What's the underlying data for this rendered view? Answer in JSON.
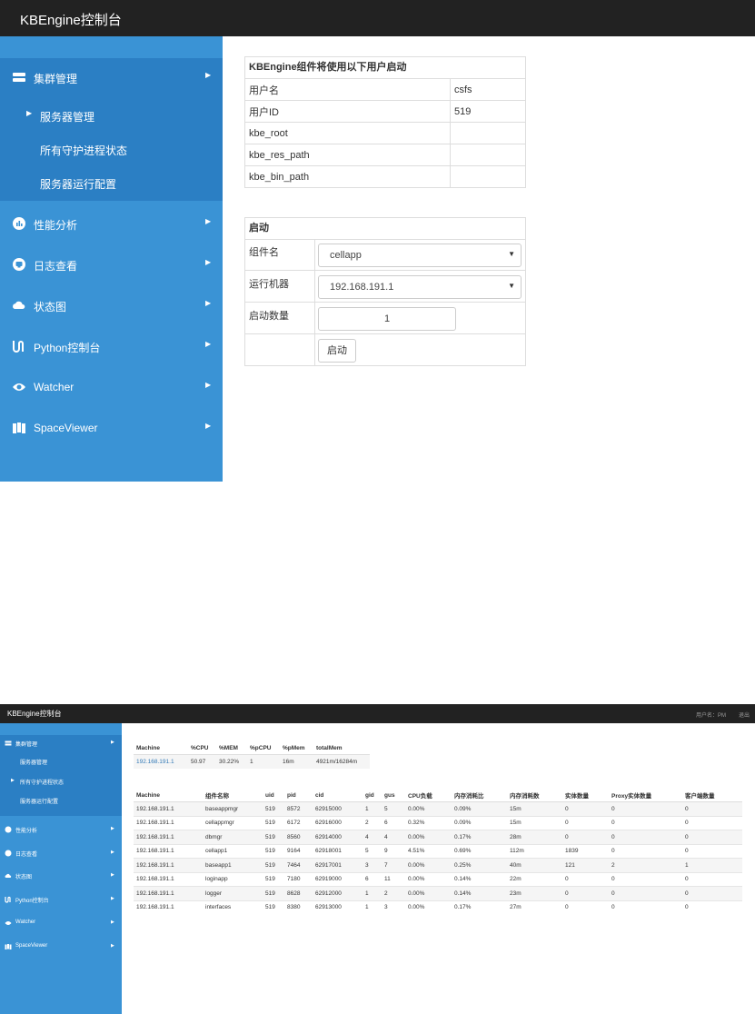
{
  "top": {
    "brand": "KBEngine控制台",
    "sidebar": {
      "groups": [
        {
          "label": "集群管理",
          "icon": "server-icon"
        },
        {
          "label": "性能分析",
          "icon": "chart-icon"
        },
        {
          "label": "日志查看",
          "icon": "log-icon"
        },
        {
          "label": "状态图",
          "icon": "cloud-icon"
        },
        {
          "label": "Python控制台",
          "icon": "terminal-icon"
        },
        {
          "label": "Watcher",
          "icon": "eye-icon"
        },
        {
          "label": "SpaceViewer",
          "icon": "map-icon"
        }
      ],
      "sub_items": [
        {
          "label": "服务器管理"
        },
        {
          "label": "所有守护进程状态"
        },
        {
          "label": "服务器运行配置"
        }
      ]
    },
    "user_panel": {
      "title": "KBEngine组件将使用以下用户启动",
      "rows": [
        {
          "key": "用户名",
          "value": "csfs"
        },
        {
          "key": "用户ID",
          "value": "519"
        },
        {
          "key": "kbe_root",
          "value": ""
        },
        {
          "key": "kbe_res_path",
          "value": ""
        },
        {
          "key": "kbe_bin_path",
          "value": ""
        }
      ]
    },
    "start_panel": {
      "title": "启动",
      "component_label": "组件名",
      "component_value": "cellapp",
      "machine_label": "运行机器",
      "machine_value": "192.168.191.1",
      "count_label": "启动数量",
      "count_value": "1",
      "start_button": "启动"
    }
  },
  "bottom": {
    "brand": "KBEngine控制台",
    "user": "用户名：PM",
    "logout": "退出",
    "sidebar": {
      "groups": [
        {
          "label": "集群管理"
        },
        {
          "label": "性能分析"
        },
        {
          "label": "日志查看"
        },
        {
          "label": "状态图"
        },
        {
          "label": "Python控制台"
        },
        {
          "label": "Watcher"
        },
        {
          "label": "SpaceViewer"
        }
      ],
      "sub_items": [
        {
          "label": "服务器管理"
        },
        {
          "label": "所有守护进程状态"
        },
        {
          "label": "服务器运行配置"
        }
      ]
    },
    "machine_table": {
      "headers": [
        "Machine",
        "%CPU",
        "%MEM",
        "%pCPU",
        "%pMem",
        "totalMem"
      ],
      "rows": [
        [
          "192.168.191.1",
          "50.97",
          "30.22%",
          "1",
          "16m",
          "4921m/16284m"
        ]
      ]
    },
    "process_table": {
      "headers": [
        "Machine",
        "组件名称",
        "uid",
        "pid",
        "cid",
        "gid",
        "gus",
        "CPU负载",
        "内存消耗比",
        "内存消耗数",
        "实体数量",
        "Proxy实体数量",
        "客户端数量"
      ],
      "rows": [
        [
          "192.168.191.1",
          "baseappmgr",
          "519",
          "8572",
          "62915000",
          "1",
          "5",
          "0.00%",
          "0.09%",
          "15m",
          "0",
          "0",
          "0"
        ],
        [
          "192.168.191.1",
          "cellappmgr",
          "519",
          "6172",
          "62916000",
          "2",
          "6",
          "0.32%",
          "0.09%",
          "15m",
          "0",
          "0",
          "0"
        ],
        [
          "192.168.191.1",
          "dbmgr",
          "519",
          "8560",
          "62914000",
          "4",
          "4",
          "0.00%",
          "0.17%",
          "28m",
          "0",
          "0",
          "0"
        ],
        [
          "192.168.191.1",
          "cellapp1",
          "519",
          "9164",
          "62918001",
          "5",
          "9",
          "4.51%",
          "0.69%",
          "112m",
          "1839",
          "0",
          "0"
        ],
        [
          "192.168.191.1",
          "baseapp1",
          "519",
          "7464",
          "62917001",
          "3",
          "7",
          "0.00%",
          "0.25%",
          "40m",
          "121",
          "2",
          "1"
        ],
        [
          "192.168.191.1",
          "loginapp",
          "519",
          "7180",
          "62919000",
          "6",
          "11",
          "0.00%",
          "0.14%",
          "22m",
          "0",
          "0",
          "0"
        ],
        [
          "192.168.191.1",
          "logger",
          "519",
          "8628",
          "62912000",
          "1",
          "2",
          "0.00%",
          "0.14%",
          "23m",
          "0",
          "0",
          "0"
        ],
        [
          "192.168.191.1",
          "interfaces",
          "519",
          "8380",
          "62913000",
          "1",
          "3",
          "0.00%",
          "0.17%",
          "27m",
          "0",
          "0",
          "0"
        ]
      ]
    }
  }
}
